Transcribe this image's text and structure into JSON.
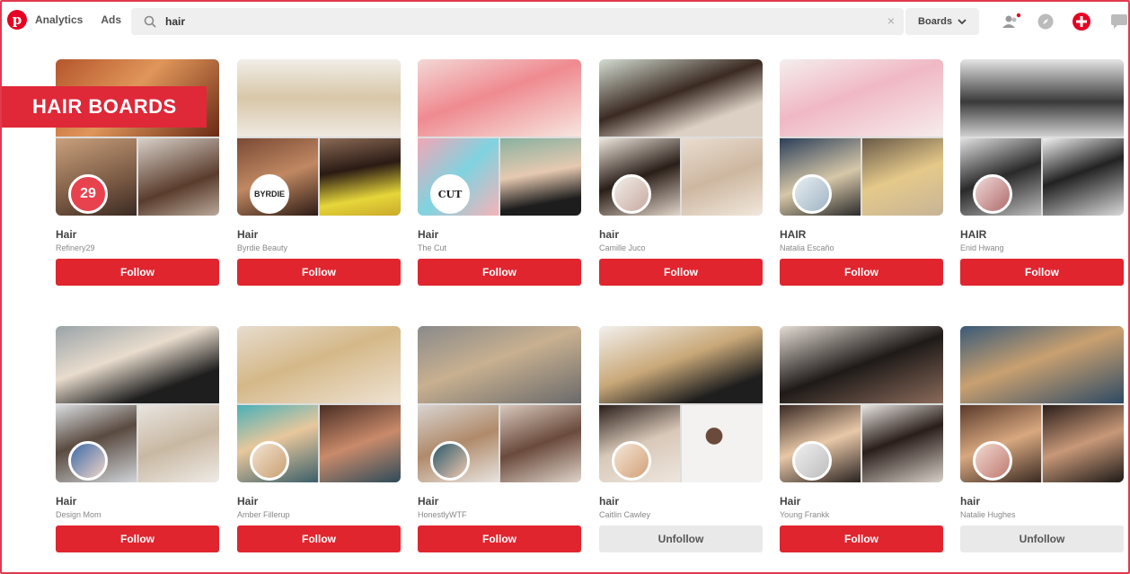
{
  "nav": {
    "analytics": "Analytics",
    "ads": "Ads"
  },
  "search": {
    "query": "hair",
    "clear": "×",
    "scope": "Boards"
  },
  "banner": "HAIR BOARDS",
  "colors": {
    "brand_red": "#e60023",
    "follow_red": "#e0252f",
    "banner_red": "#df2838",
    "unfollow_grey": "#e9e9e9"
  },
  "boards": [
    {
      "title": "Hair",
      "owner": "Refinery29",
      "action": "Follow"
    },
    {
      "title": "Hair",
      "owner": "Byrdie Beauty",
      "action": "Follow"
    },
    {
      "title": "Hair",
      "owner": "The Cut",
      "action": "Follow"
    },
    {
      "title": "hair",
      "owner": "Camille Juco",
      "action": "Follow"
    },
    {
      "title": "HAIR",
      "owner": "Natalia Escaño",
      "action": "Follow"
    },
    {
      "title": "HAIR",
      "owner": "Enid Hwang",
      "action": "Follow"
    },
    {
      "title": "Hair",
      "owner": "Design Mom",
      "action": "Follow"
    },
    {
      "title": "Hair",
      "owner": "Amber Fillerup",
      "action": "Follow"
    },
    {
      "title": "Hair",
      "owner": "HonestlyWTF",
      "action": "Follow"
    },
    {
      "title": "hair",
      "owner": "Caitlin Cawley",
      "action": "Unfollow"
    },
    {
      "title": "Hair",
      "owner": "Young Frankk",
      "action": "Follow"
    },
    {
      "title": "hair",
      "owner": "Natalie Hughes",
      "action": "Unfollow"
    }
  ],
  "avatar_labels": {
    "r29": "29",
    "byrdie": "BYRDIE",
    "cut": "CUT"
  }
}
